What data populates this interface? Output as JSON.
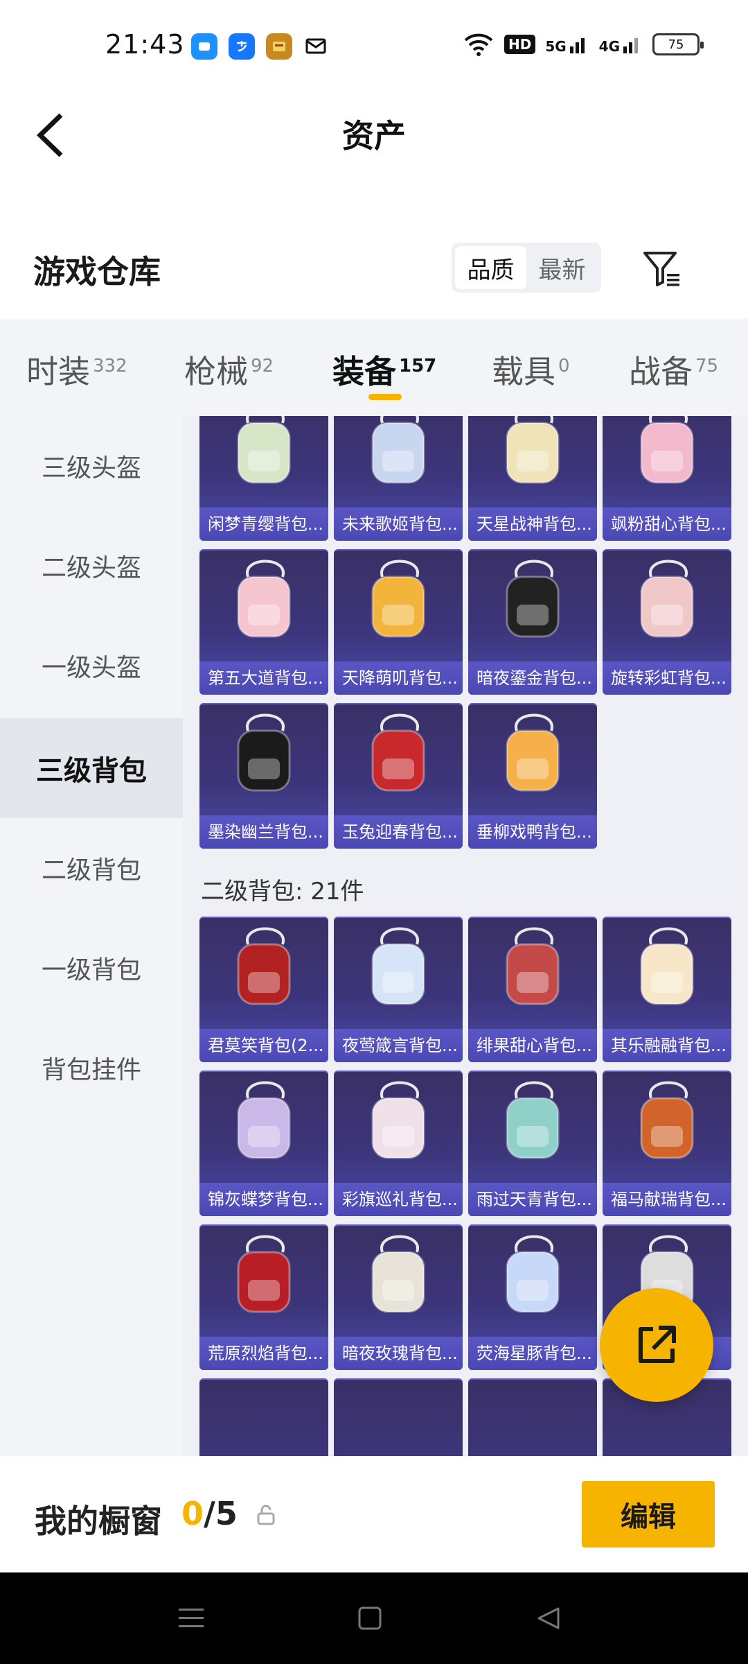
{
  "status_bar": {
    "time": "21:43",
    "battery": "75",
    "network_5g": "5G",
    "network_4g": "4G",
    "hd": "HD"
  },
  "header": {
    "title": "资产"
  },
  "warehouse": {
    "title": "游戏仓库",
    "sort_options": [
      "品质",
      "最新"
    ],
    "active_sort": "品质"
  },
  "tabs": [
    {
      "label": "时装",
      "count": "332"
    },
    {
      "label": "枪械",
      "count": "92"
    },
    {
      "label": "装备",
      "count": "157"
    },
    {
      "label": "载具",
      "count": "0"
    },
    {
      "label": "战备",
      "count": "75"
    }
  ],
  "active_tab": "装备",
  "sidenav": [
    {
      "label": "三级头盔"
    },
    {
      "label": "二级头盔"
    },
    {
      "label": "一级头盔"
    },
    {
      "label": "三级背包"
    },
    {
      "label": "二级背包"
    },
    {
      "label": "一级背包"
    },
    {
      "label": "背包挂件"
    }
  ],
  "active_side": "三级背包",
  "level3_items": [
    "闲梦青缨背包...",
    "未来歌姬背包...",
    "天星战神背包...",
    "飒粉甜心背包...",
    "第五大道背包...",
    "天降萌叽背包...",
    "暗夜鎏金背包...",
    "旋转彩虹背包...",
    "墨染幽兰背包...",
    "玉兔迎春背包...",
    "垂柳戏鸭背包..."
  ],
  "level2_section": {
    "title": "二级背包: 21件"
  },
  "level2_items": [
    "君莫笑背包(2...",
    "夜莺箴言背包...",
    "绯果甜心背包...",
    "其乐融融背包...",
    "锦灰蝶梦背包...",
    "彩旗巡礼背包...",
    "雨过天青背包...",
    "福马献瑞背包...",
    "荒原烈焰背包...",
    "暗夜玫瑰背包...",
    "荧海星豚背包...",
    "..."
  ],
  "showcase": {
    "title": "我的橱窗",
    "current": "0",
    "separator": "/",
    "max": "5",
    "edit_label": "编辑"
  },
  "colors": {
    "accent": "#f6b400",
    "card_top": "#3a3066",
    "card_label": "#5a57c4",
    "sidebar_bg": "#f2f4f8"
  }
}
